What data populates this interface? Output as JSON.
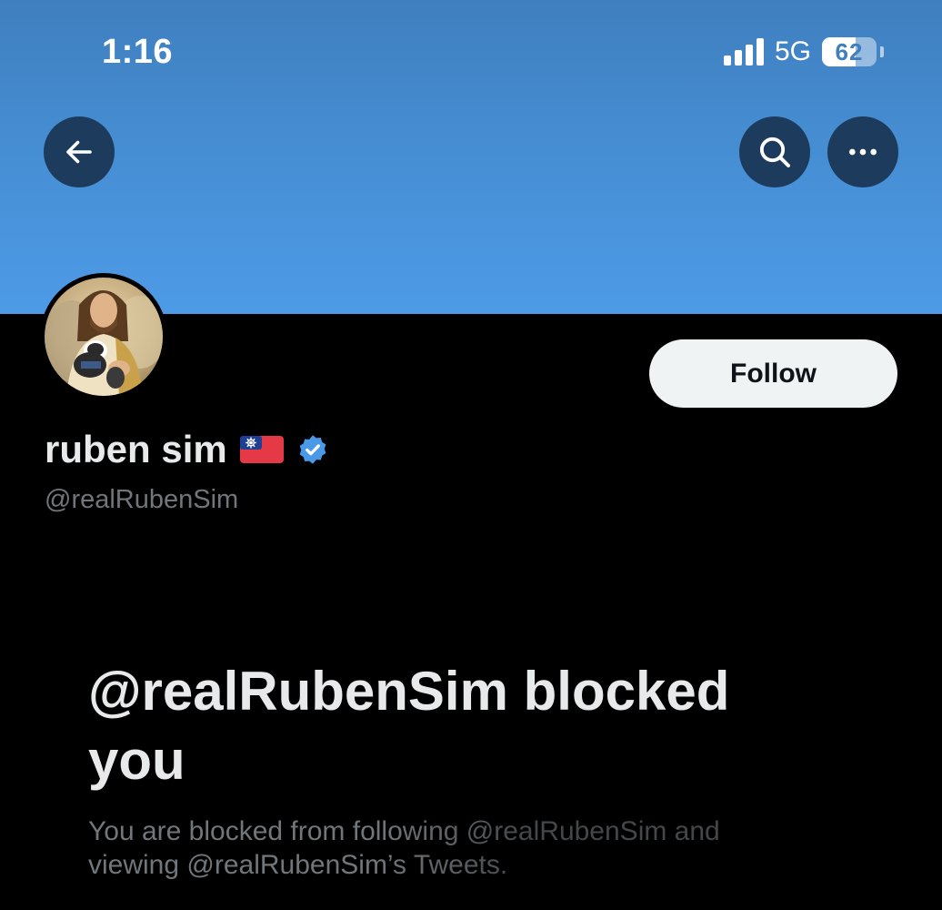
{
  "status_bar": {
    "time": "1:16",
    "network": "5G",
    "battery": "62",
    "battery_level": 0.62
  },
  "header": {
    "back_icon": "arrow-left-icon",
    "search_icon": "search-icon",
    "more_icon": "more-horizontal-icon"
  },
  "profile": {
    "display_name": "ruben sim",
    "flag_icon": "taiwan-flag-icon",
    "verified_icon": "verified-badge-icon",
    "verified_color": "#4a99e9",
    "handle": "@realRubenSim",
    "follow_label": "Follow"
  },
  "blocked_notice": {
    "title": "@realRubenSim blocked you",
    "description": "You are blocked from following @realRubenSim and viewing @realRubenSim’s Tweets."
  },
  "colors": {
    "banner": "#4790d6",
    "background": "#000000",
    "follow_button_bg": "#eff3f4",
    "secondary_text": "#71767b"
  }
}
